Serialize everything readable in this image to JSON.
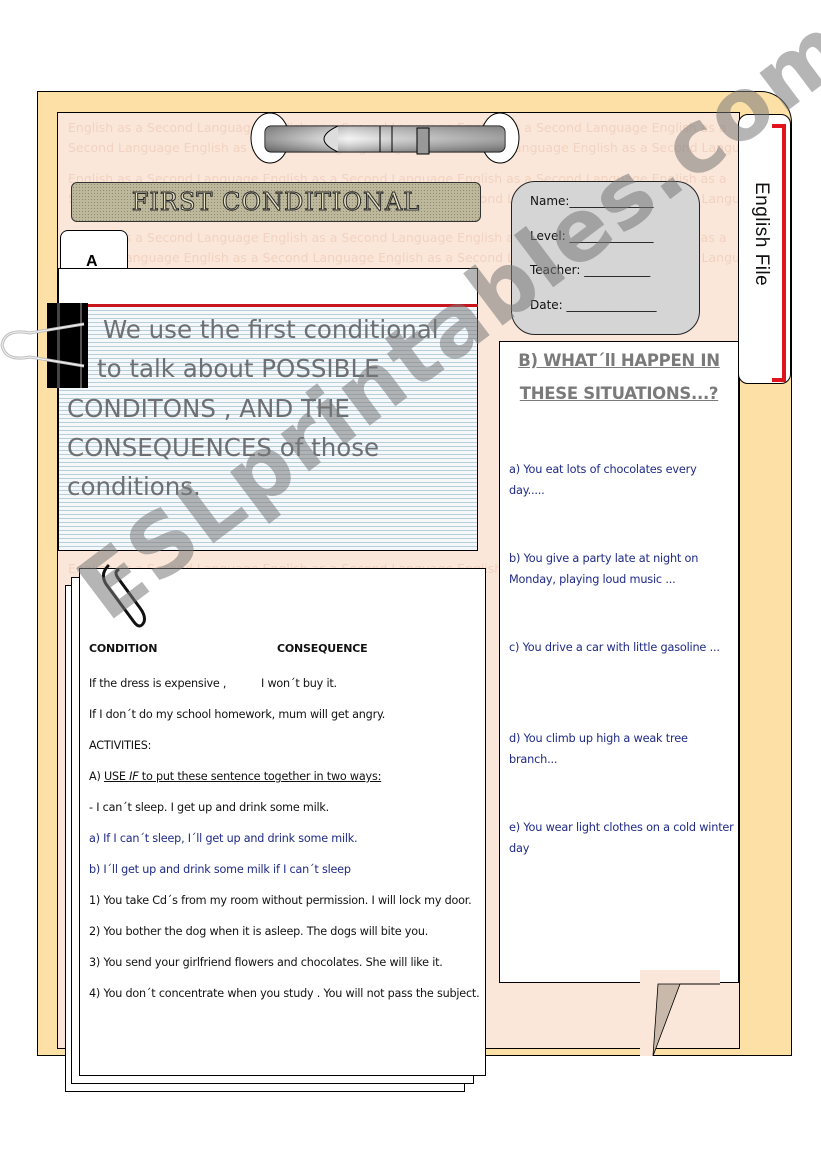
{
  "background_text": {
    "line_a": "English as a Second Language English as a Second Language English as a Second Language English as a",
    "line_b": "Second Language English as a Second Language English as a Second Language English as a Second Language"
  },
  "title": "First Conditional",
  "info_card": {
    "name": "Name:______________",
    "level": "Level: ______________",
    "teacher": "Teacher:  ___________",
    "date": "Date: _______________"
  },
  "file_tab": "English File",
  "section_a": {
    "tab_label": "A",
    "intro_line1": "We use the first conditional",
    "intro_line2": "to talk about POSSIBLE",
    "intro_line3": "CONDITONS , AND THE",
    "intro_line4": "CONSEQUENCES of those",
    "intro_line5": "conditions."
  },
  "sheet": {
    "col_condition": "CONDITION",
    "col_consequence": "CONSEQUENCE",
    "example1_condition": "If the dress is expensive ,",
    "example1_consequence": "I won´t buy it.",
    "example2": "If I don´t do my school homework, mum will get angry.",
    "activities_label": "ACTIVITIES:",
    "instruction_prefix": "A) ",
    "instruction_use": "USE ",
    "instruction_if": "IF",
    "instruction_rest": " to put these sentence together in two ways:",
    "model_sentence": "- I can´t sleep. I get up and drink some milk.",
    "model_answer_a": "a) If I can´t sleep, I´ll  get up and drink some milk.",
    "model_answer_b": "b) I´ll get up and drink some milk if I can´t sleep",
    "exercises": [
      "1) You take Cd´s from my room without permission. I will lock my door.",
      "2) You  bother  the dog when it is asleep. The dogs will bite you.",
      "3) You send your girlfriend flowers and chocolates. She will like it.",
      "4) You don´t concentrate when you  study . You will not pass the subject."
    ]
  },
  "situations": {
    "title": "B) WHAT´ll  HAPPEN IN THESE SITUATIONS...?",
    "items": [
      "a) You eat lots of chocolates every day.....",
      "b) You give a party late at night on Monday, playing loud music ...",
      "c) You drive a car with little gasoline ...",
      "d) You climb  up high  a weak  tree branch...",
      "e)  You wear  light clothes on a cold winter day"
    ]
  },
  "watermark": "ESLprintables.com",
  "colors": {
    "folder": "#fde0a6",
    "inner_page": "#fbe7da",
    "accent_red": "#e0141c",
    "answer_blue": "#1f2a86",
    "intro_grey": "#6d6f72",
    "info_card": "#d5d5d5"
  }
}
